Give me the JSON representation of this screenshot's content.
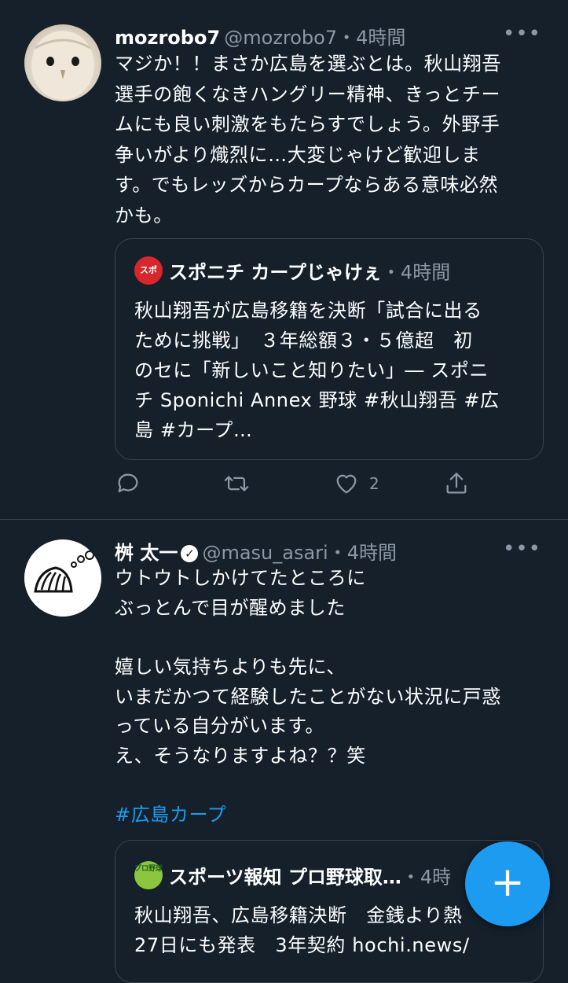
{
  "tweets": [
    {
      "name": "mozrobo7",
      "handle": "@mozrobo7",
      "time": "・4時間",
      "lines": [
        "マジか！！まさか広島を選ぶとは。秋山翔吾",
        "選手の飽くなきハングリー精神、きっとチー",
        "ムにも良い刺激をもたらすでしょう。外野手",
        "争いがより熾烈に…大変じゃけど歓迎しま",
        "す。でもレッズからカープならある意味必然",
        "かも。"
      ],
      "quote": {
        "logo_text": "スポ",
        "name": "スポニチ カープじゃけぇ",
        "time": "・4時間",
        "lines": [
          "秋山翔吾が広島移籍を決断「試合に出る",
          "ために挑戦」　３年総額３・５億超　初",
          "のセに「新しいこと知りたい」― スポニ",
          "チ Sponichi Annex 野球 #秋山翔吾 #広",
          "島 #カープ…"
        ]
      },
      "actions": {
        "reply_count": "",
        "retweet_count": "",
        "like_count": "2"
      }
    },
    {
      "name": "桝 太一",
      "verified_mark": "✓",
      "handle": "@masu_asari",
      "time": "・4時間",
      "lines": [
        "ウトウトしかけてたところに",
        "ぶっとんで目が醒めました",
        "",
        "嬉しい気持ちよりも先に、",
        "いまだかつて経験したことがない状況に戸惑",
        "っている自分がいます。",
        "え、そうなりますよね？？笑",
        "",
        "#広島カープ"
      ],
      "quote": {
        "logo_text": "プロ野球",
        "name": "スポーツ報知 プロ野球取…",
        "time": "・4時",
        "lines": [
          "秋山翔吾、広島移籍決断　金銭より熱",
          "27日にも発表　3年契約 hochi.news/"
        ]
      }
    }
  ],
  "icons": {
    "more": "more-icon",
    "reply": "reply-icon",
    "retweet": "retweet-icon",
    "like": "heart-icon",
    "share": "share-icon",
    "compose": "compose-icon"
  },
  "fab": {
    "label": "+"
  },
  "colors": {
    "background": "#15202b",
    "accent": "#1d9bf0",
    "muted": "#8b98a5",
    "border": "#38444d"
  }
}
